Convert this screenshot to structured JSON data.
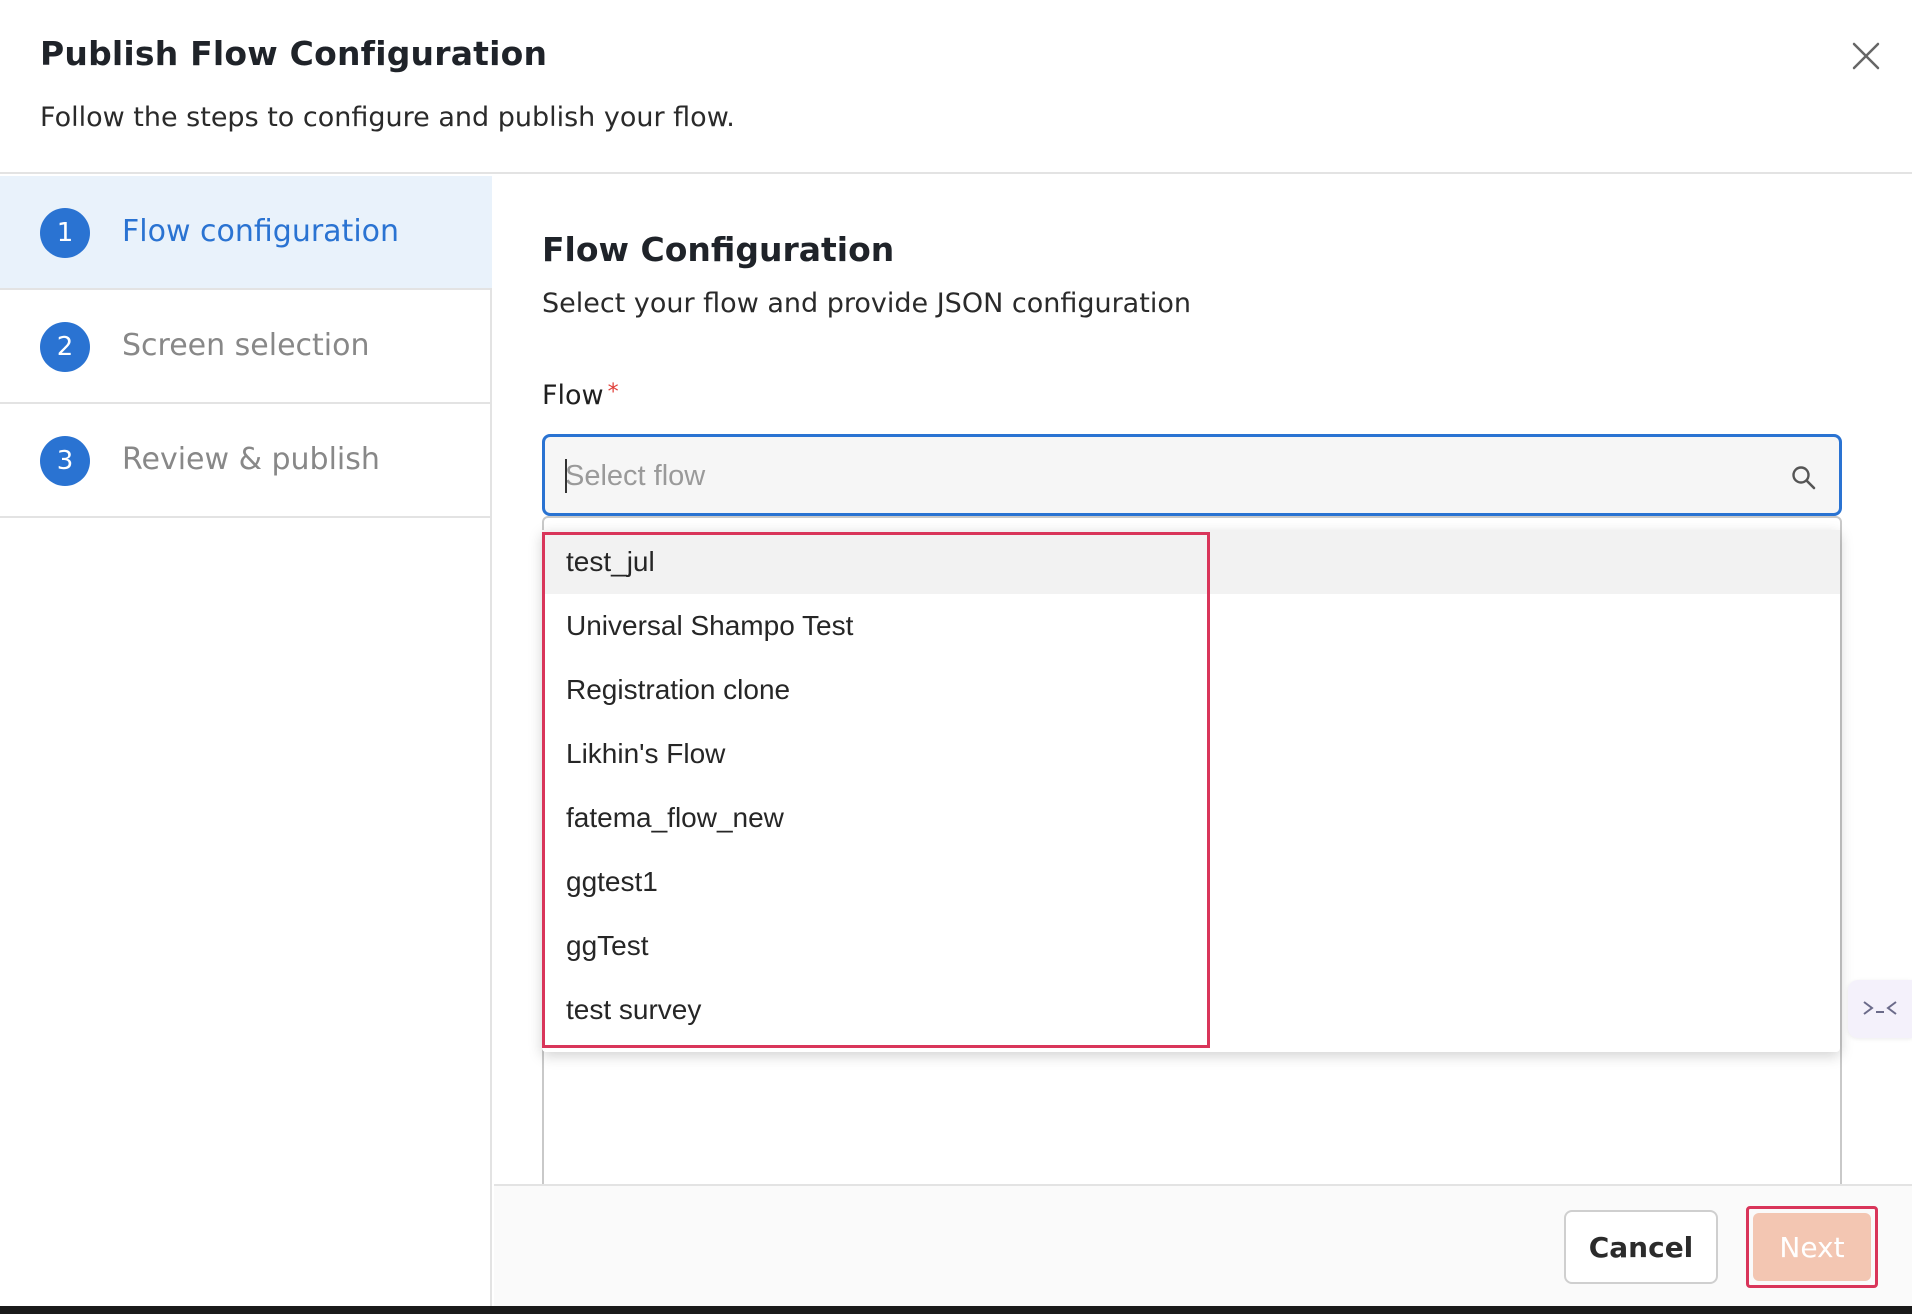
{
  "header": {
    "title": "Publish Flow Configuration",
    "subtitle": "Follow the steps to configure and publish your flow."
  },
  "steps": [
    {
      "number": "1",
      "label": "Flow configuration",
      "active": true
    },
    {
      "number": "2",
      "label": "Screen selection",
      "active": false
    },
    {
      "number": "3",
      "label": "Review & publish",
      "active": false
    }
  ],
  "main": {
    "section_title": "Flow Configuration",
    "section_description": "Select your flow and provide JSON configuration",
    "flow_label": "Flow",
    "required_mark": "*",
    "flow_placeholder": "Select flow"
  },
  "dropdown": {
    "options": [
      "test_jul",
      "Universal Shampo Test",
      "Registration clone",
      "Likhin's Flow",
      "fatema_flow_new",
      "ggtest1",
      "ggTest",
      "test survey"
    ]
  },
  "footer": {
    "cancel_label": "Cancel",
    "next_label": "Next"
  },
  "colors": {
    "accent": "#2a73d2",
    "active_step_bg": "#e9f2fb",
    "highlight": "#d9355a",
    "next_disabled": "#f3c6b2"
  },
  "icons": {
    "close": "close-icon",
    "search": "search-icon",
    "widget": "assistant-widget-icon"
  }
}
